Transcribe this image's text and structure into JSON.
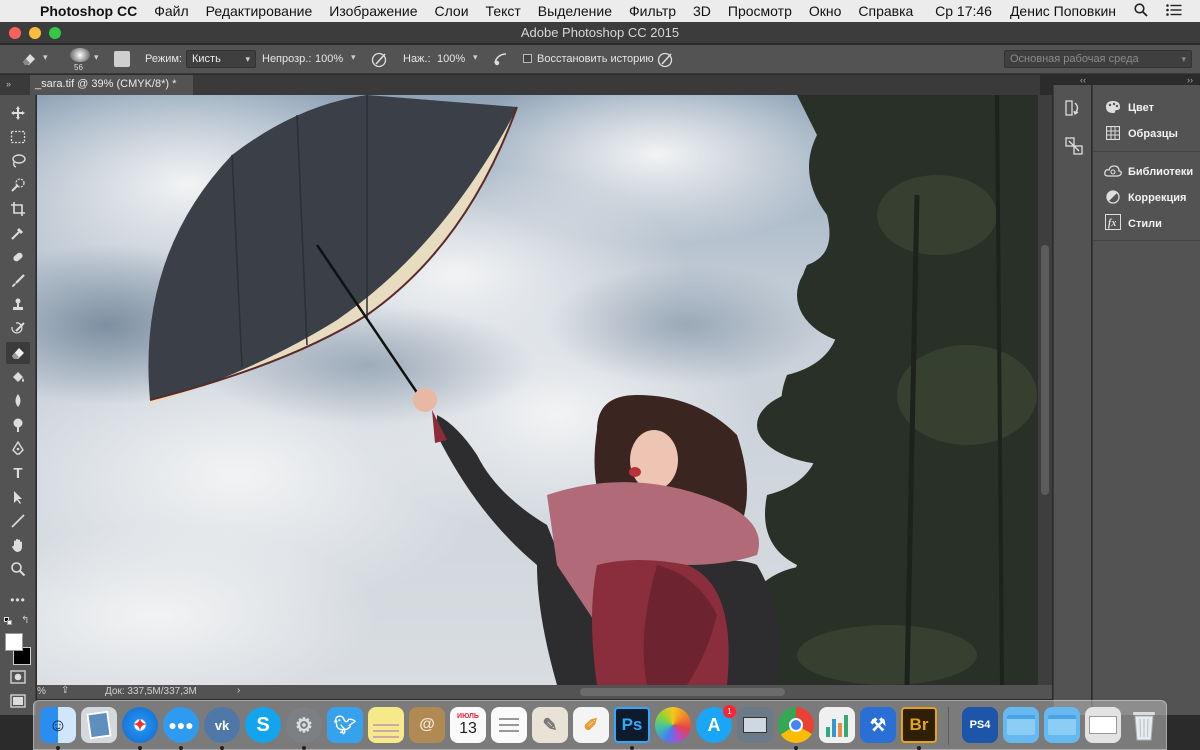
{
  "menubar": {
    "app_name": "Photoshop CC",
    "items": [
      "Файл",
      "Редактирование",
      "Изображение",
      "Слои",
      "Текст",
      "Выделение",
      "Фильтр",
      "3D",
      "Просмотр",
      "Окно",
      "Справка"
    ],
    "clock": "Ср 17:46",
    "user": "Денис Поповкин"
  },
  "window": {
    "title": "Adobe Photoshop CC 2015"
  },
  "options": {
    "brush_size": "56",
    "mode_label": "Режим:",
    "mode_value": "Кисть",
    "opacity_label": "Непрозр.:",
    "opacity_value": "100%",
    "flow_label": "Наж.:",
    "flow_value": "100%",
    "restore_history_label": "Восстановить историю",
    "workspace_value": "Основная рабочая среда"
  },
  "document": {
    "tab_title": "_sara.tif @ 39% (CMYK/8*) *",
    "zoom": "%",
    "doc_info": "Док: 337,5M/337,3M"
  },
  "panels": {
    "items": [
      {
        "label": "Цвет",
        "icon": "palette-icon"
      },
      {
        "label": "Образцы",
        "icon": "grid-icon"
      },
      {
        "label": "Библиотеки",
        "icon": "cc-libraries-icon"
      },
      {
        "label": "Коррекция",
        "icon": "adjustment-icon"
      },
      {
        "label": "Стили",
        "icon": "fx-icon"
      }
    ]
  },
  "dock": {
    "calendar_month": "ИЮЛЬ",
    "calendar_day": "13",
    "appstore_badge": "1",
    "ps_label": "Ps",
    "br_label": "Br"
  },
  "colors": {
    "panel_bg": "#535353",
    "menubar_bg": "#ececec",
    "sky": "#c9d2dc",
    "umbrella": "#3b4049",
    "scarf": "#9b3a4a"
  }
}
